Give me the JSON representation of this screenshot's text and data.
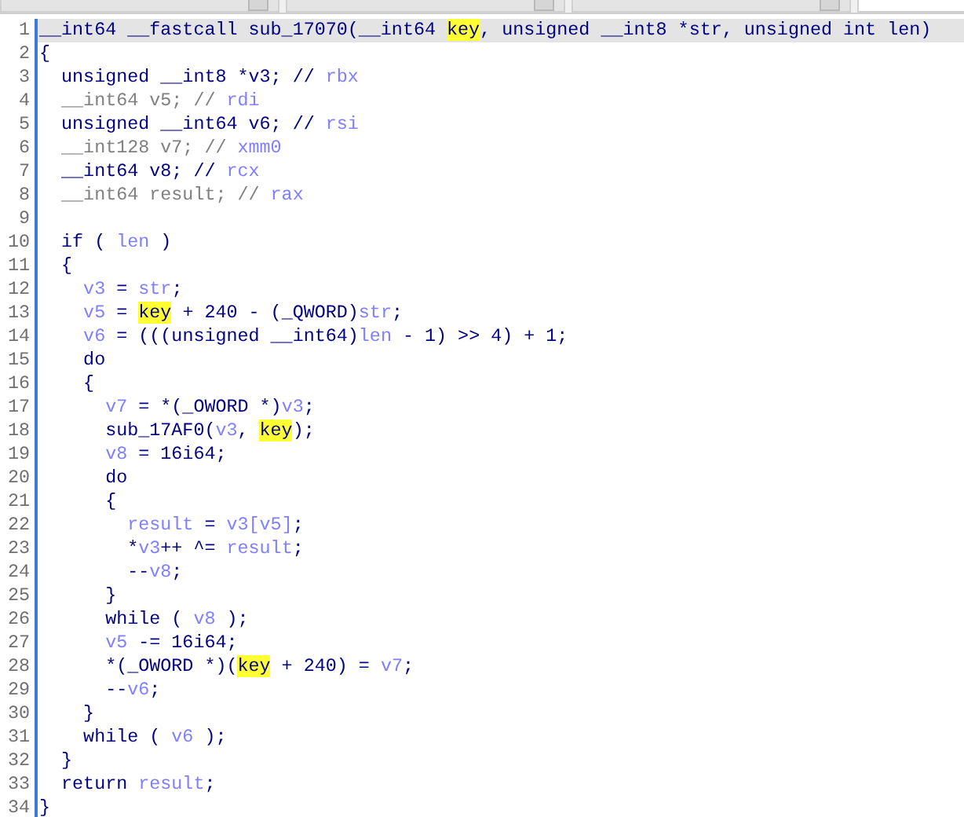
{
  "tabs": [
    {
      "selected": false
    },
    {
      "selected": false
    },
    {
      "selected": false
    },
    {
      "selected": true
    }
  ],
  "lines": [
    {
      "number": "1",
      "selected": true,
      "tokens": [
        {
          "text": "__int64 __fastcall sub_17070(__int64 ",
          "kind": "plain"
        },
        {
          "text": "key",
          "kind": "highlight"
        },
        {
          "text": ", unsigned __int8 *str, unsigned int len)",
          "kind": "plain"
        }
      ]
    },
    {
      "number": "2",
      "selected": false,
      "tokens": [
        {
          "text": "{",
          "kind": "plain"
        }
      ]
    },
    {
      "number": "3",
      "selected": false,
      "tokens": [
        {
          "text": "  unsigned __int8 *v3; // ",
          "kind": "plain"
        },
        {
          "text": "rbx",
          "kind": "ident"
        }
      ]
    },
    {
      "number": "4",
      "selected": false,
      "tokens": [
        {
          "text": "  __int64 v5; // ",
          "kind": "dim"
        },
        {
          "text": "rdi",
          "kind": "ident"
        }
      ]
    },
    {
      "number": "5",
      "selected": false,
      "tokens": [
        {
          "text": "  unsigned __int64 v6; // ",
          "kind": "plain"
        },
        {
          "text": "rsi",
          "kind": "ident"
        }
      ]
    },
    {
      "number": "6",
      "selected": false,
      "tokens": [
        {
          "text": "  __int128 v7; // ",
          "kind": "dim"
        },
        {
          "text": "xmm0",
          "kind": "ident"
        }
      ]
    },
    {
      "number": "7",
      "selected": false,
      "tokens": [
        {
          "text": "  __int64 v8; // ",
          "kind": "plain"
        },
        {
          "text": "rcx",
          "kind": "ident"
        }
      ]
    },
    {
      "number": "8",
      "selected": false,
      "tokens": [
        {
          "text": "  __int64 result; // ",
          "kind": "dim"
        },
        {
          "text": "rax",
          "kind": "ident"
        }
      ]
    },
    {
      "number": "9",
      "selected": false
    },
    {
      "number": "10",
      "selected": false,
      "tokens": [
        {
          "text": "  if ( ",
          "kind": "plain"
        },
        {
          "text": "len",
          "kind": "ident"
        },
        {
          "text": " )",
          "kind": "plain"
        }
      ]
    },
    {
      "number": "11",
      "selected": false,
      "tokens": [
        {
          "text": "  {",
          "kind": "plain"
        }
      ]
    },
    {
      "number": "12",
      "selected": false,
      "tokens": [
        {
          "text": "    v3",
          "kind": "ident"
        },
        {
          "text": " = ",
          "kind": "plain"
        },
        {
          "text": "str",
          "kind": "ident"
        },
        {
          "text": ";",
          "kind": "plain"
        }
      ]
    },
    {
      "number": "13",
      "selected": false,
      "tokens": [
        {
          "text": "    v5",
          "kind": "ident"
        },
        {
          "text": " = ",
          "kind": "plain"
        },
        {
          "text": "key",
          "kind": "highlight"
        },
        {
          "text": " + 240 - (_QWORD)",
          "kind": "plain"
        },
        {
          "text": "str",
          "kind": "ident"
        },
        {
          "text": ";",
          "kind": "plain"
        }
      ]
    },
    {
      "number": "14",
      "selected": false,
      "tokens": [
        {
          "text": "    v6",
          "kind": "ident"
        },
        {
          "text": " = (((unsigned __int64)",
          "kind": "plain"
        },
        {
          "text": "len",
          "kind": "ident"
        },
        {
          "text": " - 1) >> 4) + 1;",
          "kind": "plain"
        }
      ]
    },
    {
      "number": "15",
      "selected": false,
      "tokens": [
        {
          "text": "    do",
          "kind": "plain"
        }
      ]
    },
    {
      "number": "16",
      "selected": false,
      "tokens": [
        {
          "text": "    {",
          "kind": "plain"
        }
      ]
    },
    {
      "number": "17",
      "selected": false,
      "tokens": [
        {
          "text": "      v7",
          "kind": "ident"
        },
        {
          "text": " = *(_OWORD *)",
          "kind": "plain"
        },
        {
          "text": "v3",
          "kind": "ident"
        },
        {
          "text": ";",
          "kind": "plain"
        }
      ]
    },
    {
      "number": "18",
      "selected": false,
      "tokens": [
        {
          "text": "      sub_17AF0(",
          "kind": "plain"
        },
        {
          "text": "v3",
          "kind": "ident"
        },
        {
          "text": ", ",
          "kind": "plain"
        },
        {
          "text": "key",
          "kind": "highlight"
        },
        {
          "text": ");",
          "kind": "plain"
        }
      ]
    },
    {
      "number": "19",
      "selected": false,
      "tokens": [
        {
          "text": "      v8",
          "kind": "ident"
        },
        {
          "text": " = 16i64;",
          "kind": "plain"
        }
      ]
    },
    {
      "number": "20",
      "selected": false,
      "tokens": [
        {
          "text": "      do",
          "kind": "plain"
        }
      ]
    },
    {
      "number": "21",
      "selected": false,
      "tokens": [
        {
          "text": "      {",
          "kind": "plain"
        }
      ]
    },
    {
      "number": "22",
      "selected": false,
      "tokens": [
        {
          "text": "        result",
          "kind": "ident"
        },
        {
          "text": " = ",
          "kind": "plain"
        },
        {
          "text": "v3[v5]",
          "kind": "ident"
        },
        {
          "text": ";",
          "kind": "plain"
        }
      ]
    },
    {
      "number": "23",
      "selected": false,
      "tokens": [
        {
          "text": "        *",
          "kind": "plain"
        },
        {
          "text": "v3",
          "kind": "ident"
        },
        {
          "text": "++ ^= ",
          "kind": "plain"
        },
        {
          "text": "result",
          "kind": "ident"
        },
        {
          "text": ";",
          "kind": "plain"
        }
      ]
    },
    {
      "number": "24",
      "selected": false,
      "tokens": [
        {
          "text": "        --",
          "kind": "plain"
        },
        {
          "text": "v8",
          "kind": "ident"
        },
        {
          "text": ";",
          "kind": "plain"
        }
      ]
    },
    {
      "number": "25",
      "selected": false,
      "tokens": [
        {
          "text": "      }",
          "kind": "plain"
        }
      ]
    },
    {
      "number": "26",
      "selected": false,
      "tokens": [
        {
          "text": "      while ( ",
          "kind": "plain"
        },
        {
          "text": "v8",
          "kind": "ident"
        },
        {
          "text": " );",
          "kind": "plain"
        }
      ]
    },
    {
      "number": "27",
      "selected": false,
      "tokens": [
        {
          "text": "      v5",
          "kind": "ident"
        },
        {
          "text": " -= 16i64;",
          "kind": "plain"
        }
      ]
    },
    {
      "number": "28",
      "selected": false,
      "tokens": [
        {
          "text": "      *(_OWORD *)(",
          "kind": "plain"
        },
        {
          "text": "key",
          "kind": "highlight"
        },
        {
          "text": " + 240) = ",
          "kind": "plain"
        },
        {
          "text": "v7",
          "kind": "ident"
        },
        {
          "text": ";",
          "kind": "plain"
        }
      ]
    },
    {
      "number": "29",
      "selected": false,
      "tokens": [
        {
          "text": "      --",
          "kind": "plain"
        },
        {
          "text": "v6",
          "kind": "ident"
        },
        {
          "text": ";",
          "kind": "plain"
        }
      ]
    },
    {
      "number": "30",
      "selected": false,
      "tokens": [
        {
          "text": "    }",
          "kind": "plain"
        }
      ]
    },
    {
      "number": "31",
      "selected": false,
      "tokens": [
        {
          "text": "    while ( ",
          "kind": "plain"
        },
        {
          "text": "v6",
          "kind": "ident"
        },
        {
          "text": " );",
          "kind": "plain"
        }
      ]
    },
    {
      "number": "32",
      "selected": false,
      "tokens": [
        {
          "text": "  }",
          "kind": "plain"
        }
      ]
    },
    {
      "number": "33",
      "selected": false,
      "tokens": [
        {
          "text": "  return ",
          "kind": "plain"
        },
        {
          "text": "result",
          "kind": "ident"
        },
        {
          "text": ";",
          "kind": "plain"
        }
      ]
    },
    {
      "number": "34",
      "selected": false,
      "tokens": [
        {
          "text": "}",
          "kind": "plain"
        }
      ]
    }
  ]
}
